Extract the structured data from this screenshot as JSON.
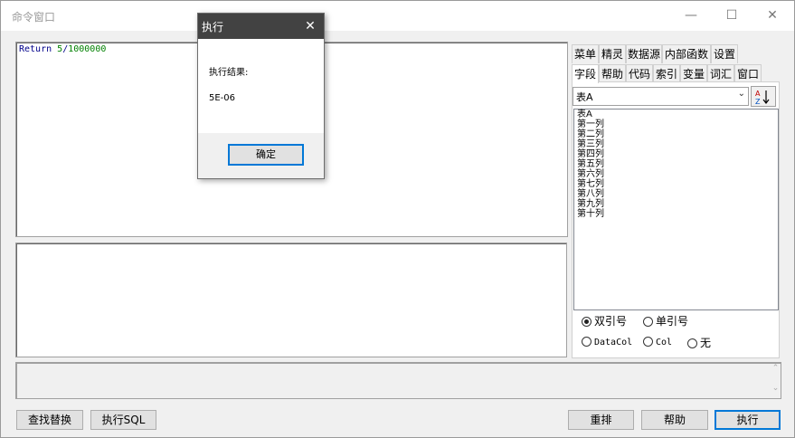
{
  "window": {
    "title": "命令窗口",
    "minimize": "—",
    "maximize": "☐",
    "close": "✕"
  },
  "editor": {
    "keyword": "Return",
    "expr_a": "5",
    "slash": "/",
    "expr_b": "1000000"
  },
  "tabs_row1": [
    "菜单",
    "精灵",
    "数据源",
    "内部函数",
    "设置"
  ],
  "tabs_row2": [
    "字段",
    "帮助",
    "代码",
    "索引",
    "变量",
    "词汇",
    "窗口"
  ],
  "selected_tab": "字段",
  "table_combo": {
    "value": "表A"
  },
  "sort_button_icon": "az-sort-icon",
  "fields": [
    "表A",
    "第一列",
    "第二列",
    "第三列",
    "第四列",
    "第五列",
    "第六列",
    "第七列",
    "第八列",
    "第九列",
    "第十列"
  ],
  "quote_options": {
    "double": "双引号",
    "single": "单引号",
    "datacol": "DataCol",
    "col": "Col",
    "none": "无"
  },
  "buttons": {
    "find_replace": "查找替换",
    "exec_sql": "执行SQL",
    "rearrange": "重排",
    "help": "帮助",
    "execute": "执行"
  },
  "dialog": {
    "title": "执行",
    "close": "✕",
    "label": "执行结果:",
    "result": "5E-06",
    "ok": "确定"
  },
  "colors": {
    "keyword": "#00008b",
    "number": "#008000",
    "dialog_titlebar": "#424242",
    "default_button_border": "#0078d7"
  }
}
